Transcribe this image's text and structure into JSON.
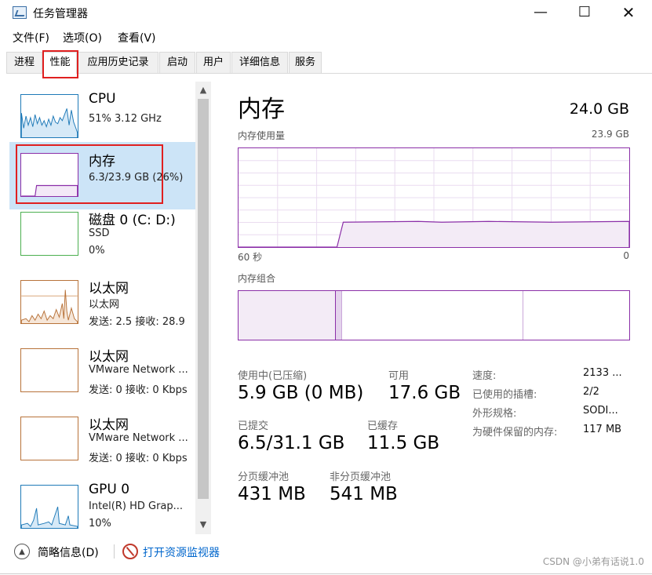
{
  "window": {
    "title": "任务管理器",
    "min": "—",
    "max": "☐",
    "close": "✕"
  },
  "menu": [
    "文件(F)",
    "选项(O)",
    "查看(V)"
  ],
  "tabs": [
    {
      "label": "进程",
      "active": false
    },
    {
      "label": "性能",
      "active": true
    },
    {
      "label": "应用历史记录",
      "active": false
    },
    {
      "label": "启动",
      "active": false
    },
    {
      "label": "用户",
      "active": false
    },
    {
      "label": "详细信息",
      "active": false
    },
    {
      "label": "服务",
      "active": false
    }
  ],
  "sidebar": [
    {
      "name": "CPU",
      "line1": "51% 3.12 GHz",
      "line2": "",
      "color": "#1f7ab8",
      "selected": false
    },
    {
      "name": "内存",
      "line1": "6.3/23.9 GB (26%)",
      "line2": "",
      "color": "#8b2fa8",
      "selected": true
    },
    {
      "name": "磁盘 0 (C: D:)",
      "line1": "SSD",
      "line2": "0%",
      "color": "#4caf50",
      "selected": false
    },
    {
      "name": "以太网",
      "line1": "以太网",
      "line2": "发送: 2.5  接收: 28.9",
      "color": "#b8733a",
      "selected": false
    },
    {
      "name": "以太网",
      "line1": "VMware Network ...",
      "line2": "发送: 0 接收: 0 Kbps",
      "color": "#b8733a",
      "selected": false
    },
    {
      "name": "以太网",
      "line1": "VMware Network ...",
      "line2": "发送: 0 接收: 0 Kbps",
      "color": "#b8733a",
      "selected": false
    },
    {
      "name": "GPU 0",
      "line1": "Intel(R) HD Grap...",
      "line2": "10%",
      "color": "#1f7ab8",
      "selected": false
    }
  ],
  "main": {
    "title": "内存",
    "total": "24.0 GB",
    "usage_label": "内存使用量",
    "usage_max": "23.9 GB",
    "time_label": "60 秒",
    "time_end": "0",
    "composition_label": "内存组合",
    "usage_fraction": 0.26,
    "stats": [
      {
        "label": "使用中(已压缩)",
        "value": "5.9 GB (0 MB)"
      },
      {
        "label": "可用",
        "value": "17.6 GB"
      },
      {
        "label": "已提交",
        "value": "6.5/31.1 GB"
      },
      {
        "label": "已缓存",
        "value": "11.5 GB"
      },
      {
        "label": "分页缓冲池",
        "value": "431 MB"
      },
      {
        "label": "非分页缓冲池",
        "value": "541 MB"
      }
    ],
    "properties": [
      {
        "label": "速度:",
        "value": "2133 ..."
      },
      {
        "label": "已使用的插槽:",
        "value": "2/2"
      },
      {
        "label": "外形规格:",
        "value": "SODI..."
      },
      {
        "label": "为硬件保留的内存:",
        "value": "117 MB"
      }
    ]
  },
  "footer": {
    "fewer_details": "简略信息(D)",
    "open_monitor": "打开资源监视器",
    "watermark": "CSDN @小弟有话说1.0"
  },
  "colors": {
    "memory": "#8b2fa8",
    "highlight": "#e02020",
    "selected_bg": "#cce4f7",
    "link": "#0066cc"
  }
}
